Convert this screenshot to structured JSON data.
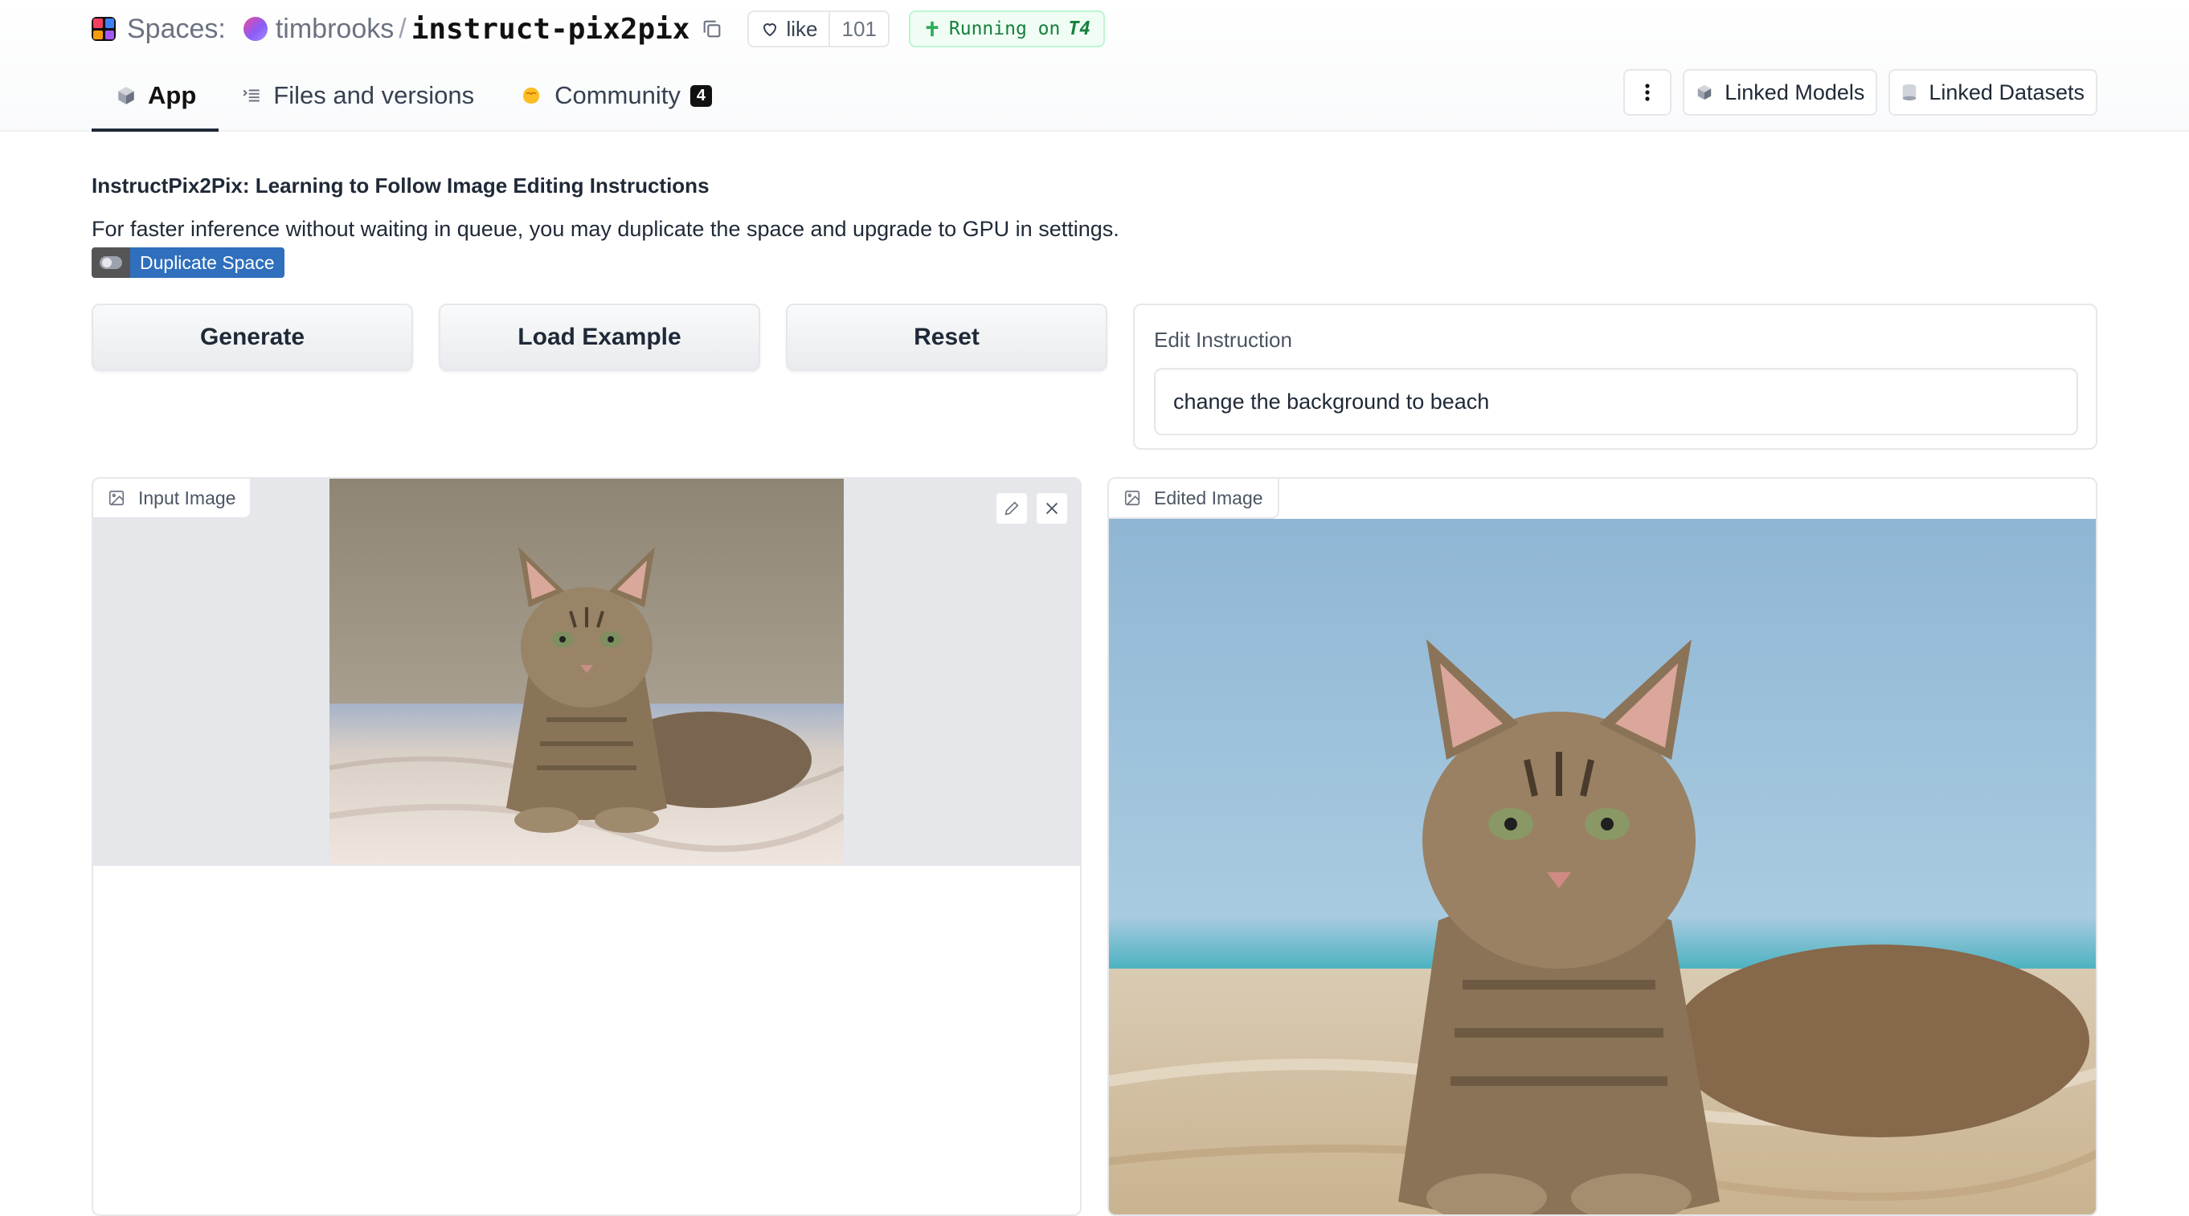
{
  "header": {
    "spaces_label": "Spaces:",
    "owner": "timbrooks",
    "separator": "/",
    "repo": "instruct-pix2pix",
    "like_label": "like",
    "like_count": "101",
    "running_prefix": "Running on",
    "running_hardware": "T4"
  },
  "tabs": [
    {
      "label": "App",
      "icon": "cube-icon",
      "active": true
    },
    {
      "label": "Files and versions",
      "icon": "files-icon"
    },
    {
      "label": "Community",
      "icon": "community-icon",
      "badge": "4"
    }
  ],
  "actions": {
    "linked_models": "Linked Models",
    "linked_datasets": "Linked Datasets"
  },
  "app": {
    "title": "InstructPix2Pix: Learning to Follow Image Editing Instructions",
    "description": "For faster inference without waiting in queue, you may duplicate the space and upgrade to GPU in settings.",
    "duplicate_label": "Duplicate Space",
    "buttons": {
      "generate": "Generate",
      "load_example": "Load Example",
      "reset": "Reset"
    },
    "instruction": {
      "label": "Edit Instruction",
      "value": "change the background to beach"
    },
    "input_image_label": "Input Image",
    "edited_image_label": "Edited Image"
  },
  "colors": {
    "accent_green": "#15803d",
    "duplicate_blue": "#2f6fbd",
    "header_bg": "#f9fafb"
  }
}
